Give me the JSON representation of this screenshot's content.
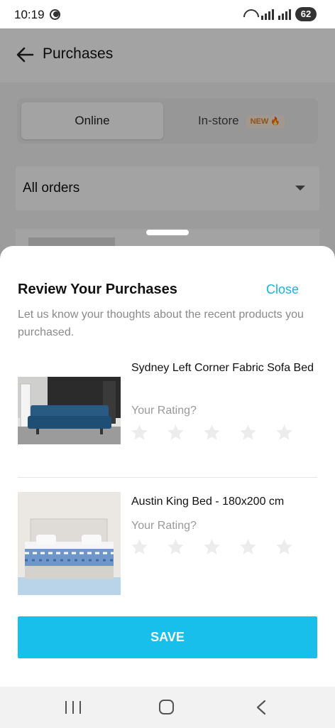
{
  "status_bar": {
    "time": "10:19",
    "battery": "62"
  },
  "app": {
    "title": "Purchases",
    "tabs": [
      {
        "label": "Online",
        "selected": true
      },
      {
        "label": "In-store",
        "badge": "NEW",
        "selected": false
      }
    ],
    "filter": {
      "selected": "All orders"
    }
  },
  "sheet": {
    "title": "Review Your Purchases",
    "close_label": "Close",
    "subtitle": "Let us know your thoughts about the recent products you purchased.",
    "products": [
      {
        "name": "Sydney Left Corner Fabric Sofa Bed",
        "rating_label": "Your Rating?",
        "rating": 0,
        "max_rating": 5
      },
      {
        "name": "Austin King Bed - 180x200 cm",
        "rating_label": "Your Rating?",
        "rating": 0,
        "max_rating": 5
      }
    ],
    "save_label": "SAVE"
  },
  "colors": {
    "accent": "#18bfea",
    "link": "#19b4e4",
    "badge": "#e0822d"
  },
  "icons": {
    "back": "arrow-left-icon",
    "star": "star-outline-icon",
    "nav": [
      "recents-icon",
      "home-icon",
      "back-icon"
    ]
  }
}
